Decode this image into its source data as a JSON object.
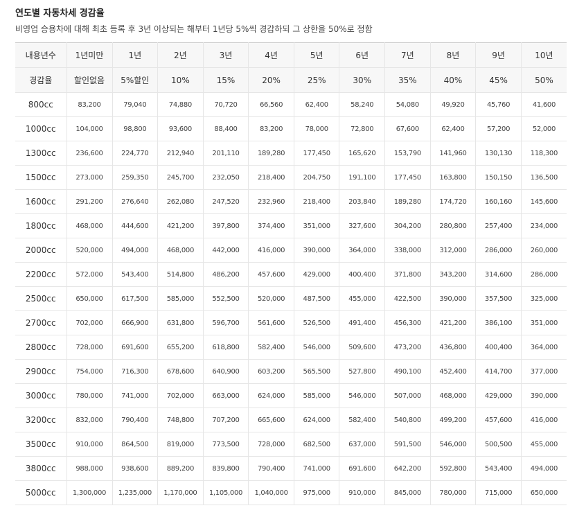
{
  "page": {
    "title": "연도별 자동차세 경감율",
    "subtitle": "비영업 승용차에 대해 최초 등록 후 3년 이상되는 해부터 1년당 5%씩 경감하되 그 상한을 50%로 정함"
  },
  "table": {
    "header_row1": [
      "내용년수",
      "1년미만",
      "1년",
      "2년",
      "3년",
      "4년",
      "5년",
      "6년",
      "7년",
      "8년",
      "9년",
      "10년"
    ],
    "header_row2": [
      "경감율",
      "할인없음",
      "5%할인",
      "10%",
      "15%",
      "20%",
      "25%",
      "30%",
      "35%",
      "40%",
      "45%",
      "50%"
    ],
    "rows": [
      [
        "800cc",
        "83,200",
        "79,040",
        "74,880",
        "70,720",
        "66,560",
        "62,400",
        "58,240",
        "54,080",
        "49,920",
        "45,760",
        "41,600"
      ],
      [
        "1000cc",
        "104,000",
        "98,800",
        "93,600",
        "88,400",
        "83,200",
        "78,000",
        "72,800",
        "67,600",
        "62,400",
        "57,200",
        "52,000"
      ],
      [
        "1300cc",
        "236,600",
        "224,770",
        "212,940",
        "201,110",
        "189,280",
        "177,450",
        "165,620",
        "153,790",
        "141,960",
        "130,130",
        "118,300"
      ],
      [
        "1500cc",
        "273,000",
        "259,350",
        "245,700",
        "232,050",
        "218,400",
        "204,750",
        "191,100",
        "177,450",
        "163,800",
        "150,150",
        "136,500"
      ],
      [
        "1600cc",
        "291,200",
        "276,640",
        "262,080",
        "247,520",
        "232,960",
        "218,400",
        "203,840",
        "189,280",
        "174,720",
        "160,160",
        "145,600"
      ],
      [
        "1800cc",
        "468,000",
        "444,600",
        "421,200",
        "397,800",
        "374,400",
        "351,000",
        "327,600",
        "304,200",
        "280,800",
        "257,400",
        "234,000"
      ],
      [
        "2000cc",
        "520,000",
        "494,000",
        "468,000",
        "442,000",
        "416,000",
        "390,000",
        "364,000",
        "338,000",
        "312,000",
        "286,000",
        "260,000"
      ],
      [
        "2200cc",
        "572,000",
        "543,400",
        "514,800",
        "486,200",
        "457,600",
        "429,000",
        "400,400",
        "371,800",
        "343,200",
        "314,600",
        "286,000"
      ],
      [
        "2500cc",
        "650,000",
        "617,500",
        "585,000",
        "552,500",
        "520,000",
        "487,500",
        "455,000",
        "422,500",
        "390,000",
        "357,500",
        "325,000"
      ],
      [
        "2700cc",
        "702,000",
        "666,900",
        "631,800",
        "596,700",
        "561,600",
        "526,500",
        "491,400",
        "456,300",
        "421,200",
        "386,100",
        "351,000"
      ],
      [
        "2800cc",
        "728,000",
        "691,600",
        "655,200",
        "618,800",
        "582,400",
        "546,000",
        "509,600",
        "473,200",
        "436,800",
        "400,400",
        "364,000"
      ],
      [
        "2900cc",
        "754,000",
        "716,300",
        "678,600",
        "640,900",
        "603,200",
        "565,500",
        "527,800",
        "490,100",
        "452,400",
        "414,700",
        "377,000"
      ],
      [
        "3000cc",
        "780,000",
        "741,000",
        "702,000",
        "663,000",
        "624,000",
        "585,000",
        "546,000",
        "507,000",
        "468,000",
        "429,000",
        "390,000"
      ],
      [
        "3200cc",
        "832,000",
        "790,400",
        "748,800",
        "707,200",
        "665,600",
        "624,000",
        "582,400",
        "540,800",
        "499,200",
        "457,600",
        "416,000"
      ],
      [
        "3500cc",
        "910,000",
        "864,500",
        "819,000",
        "773,500",
        "728,000",
        "682,500",
        "637,000",
        "591,500",
        "546,000",
        "500,500",
        "455,000"
      ],
      [
        "3800cc",
        "988,000",
        "938,600",
        "889,200",
        "839,800",
        "790,400",
        "741,000",
        "691,600",
        "642,200",
        "592,800",
        "543,400",
        "494,000"
      ],
      [
        "5000cc",
        "1,300,000",
        "1,235,000",
        "1,170,000",
        "1,105,000",
        "1,040,000",
        "975,000",
        "910,000",
        "845,000",
        "780,000",
        "715,000",
        "650,000"
      ]
    ]
  }
}
